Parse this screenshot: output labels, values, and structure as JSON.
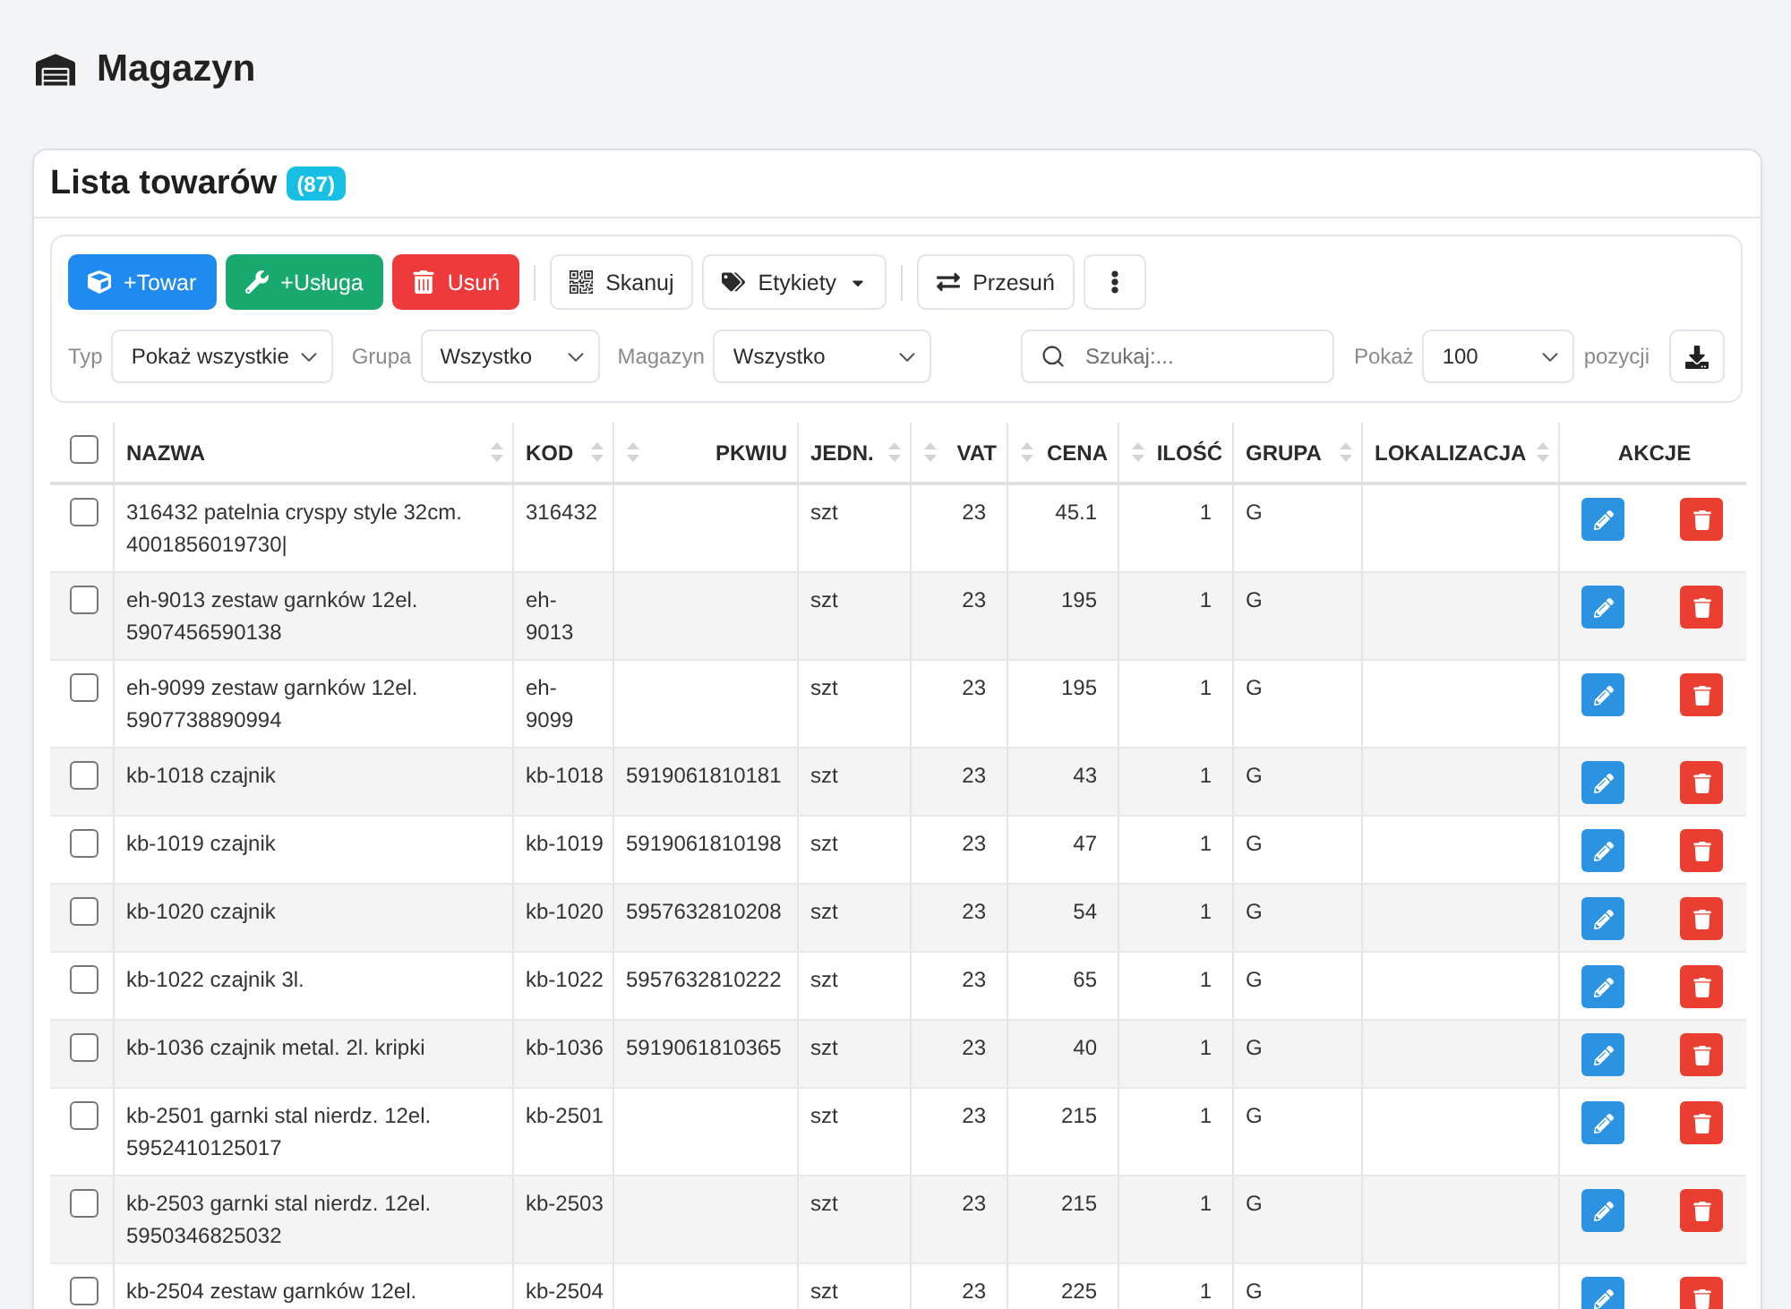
{
  "page": {
    "title": "Magazyn"
  },
  "card": {
    "title": "Lista towarów",
    "count": "(87)"
  },
  "toolbar": {
    "groups": [
      [
        {
          "kind": "primary",
          "label": "+Towar",
          "dropdown": false
        },
        {
          "kind": "success",
          "label": "+Usługa",
          "dropdown": false
        },
        {
          "kind": "danger",
          "label": "Usuń",
          "dropdown": false
        }
      ],
      [
        {
          "kind": "default",
          "label": "Skanuj",
          "dropdown": false
        },
        {
          "kind": "default",
          "label": "Etykiety",
          "dropdown": true
        }
      ],
      [
        {
          "kind": "default",
          "label": "Przesuń",
          "dropdown": false
        },
        {
          "kind": "default",
          "dropdown": false
        }
      ]
    ]
  },
  "filters": [
    {
      "label": "Typ",
      "value": "Pokaż wszystkie"
    },
    {
      "label": "Grupa",
      "value": "Wszystko"
    },
    {
      "label": "Magazyn",
      "value": "Wszystko"
    }
  ],
  "search": {
    "placeholder": "Szukaj:..."
  },
  "page_size": {
    "label": "Pokaż",
    "value": "100",
    "suffix": "pozycji"
  },
  "table": {
    "select_all": {
      "checked": false
    },
    "columns": [
      {
        "label": "NAZWA",
        "kind": "text"
      },
      {
        "label": "KOD",
        "kind": "text"
      },
      {
        "label": "PKWIU",
        "kind": "code"
      },
      {
        "label": "JEDN.",
        "kind": "text"
      },
      {
        "label": "VAT",
        "kind": "number"
      },
      {
        "label": "CENA",
        "kind": "number"
      },
      {
        "label": "ILOŚĆ",
        "kind": "number"
      },
      {
        "label": "GRUPA",
        "kind": "text"
      },
      {
        "label": "LOKALIZACJA",
        "kind": "text"
      },
      {
        "label": "AKCJE",
        "kind": "actions"
      }
    ],
    "rows": [
      {
        "checked": false,
        "name": "316432 patelnia cryspy style 32cm. 4001856019730|",
        "code": "316432",
        "unit": "szt",
        "vat": "23",
        "price": "45.1",
        "quantity": "1",
        "group": "G"
      },
      {
        "checked": false,
        "name": "eh-9013 zestaw garnków 12el. 5907456590138",
        "code": "eh-9013",
        "unit": "szt",
        "vat": "23",
        "price": "195",
        "quantity": "1",
        "group": "G"
      },
      {
        "checked": false,
        "name": "eh-9099 zestaw garnków 12el. 5907738890994",
        "code": "eh-9099",
        "unit": "szt",
        "vat": "23",
        "price": "195",
        "quantity": "1",
        "group": "G"
      },
      {
        "checked": false,
        "name": "kb-1018 czajnik",
        "code": "kb-1018",
        "pkwiu": "5919061810181",
        "unit": "szt",
        "vat": "23",
        "price": "43",
        "quantity": "1",
        "group": "G"
      },
      {
        "checked": false,
        "name": "kb-1019 czajnik",
        "code": "kb-1019",
        "pkwiu": "5919061810198",
        "unit": "szt",
        "vat": "23",
        "price": "47",
        "quantity": "1",
        "group": "G"
      },
      {
        "checked": false,
        "name": "kb-1020 czajnik",
        "code": "kb-1020",
        "pkwiu": "5957632810208",
        "unit": "szt",
        "vat": "23",
        "price": "54",
        "quantity": "1",
        "group": "G"
      },
      {
        "checked": false,
        "name": "kb-1022 czajnik 3l.",
        "code": "kb-1022",
        "pkwiu": "5957632810222",
        "unit": "szt",
        "vat": "23",
        "price": "65",
        "quantity": "1",
        "group": "G"
      },
      {
        "checked": false,
        "name": "kb-1036 czajnik metal. 2l. kripki",
        "code": "kb-1036",
        "pkwiu": "5919061810365",
        "unit": "szt",
        "vat": "23",
        "price": "40",
        "quantity": "1",
        "group": "G"
      },
      {
        "checked": false,
        "name": "kb-2501 garnki stal nierdz. 12el. 5952410125017",
        "code": "kb-2501",
        "unit": "szt",
        "vat": "23",
        "price": "215",
        "quantity": "1",
        "group": "G"
      },
      {
        "checked": false,
        "name": "kb-2503 garnki stal nierdz. 12el. 5950346825032",
        "code": "kb-2503",
        "unit": "szt",
        "vat": "23",
        "price": "215",
        "quantity": "1",
        "group": "G"
      },
      {
        "checked": false,
        "name": "kb-2504 zestaw garnków 12el.",
        "code": "kb-2504",
        "unit": "szt",
        "vat": "23",
        "price": "225",
        "quantity": "1",
        "group": "G"
      }
    ]
  }
}
